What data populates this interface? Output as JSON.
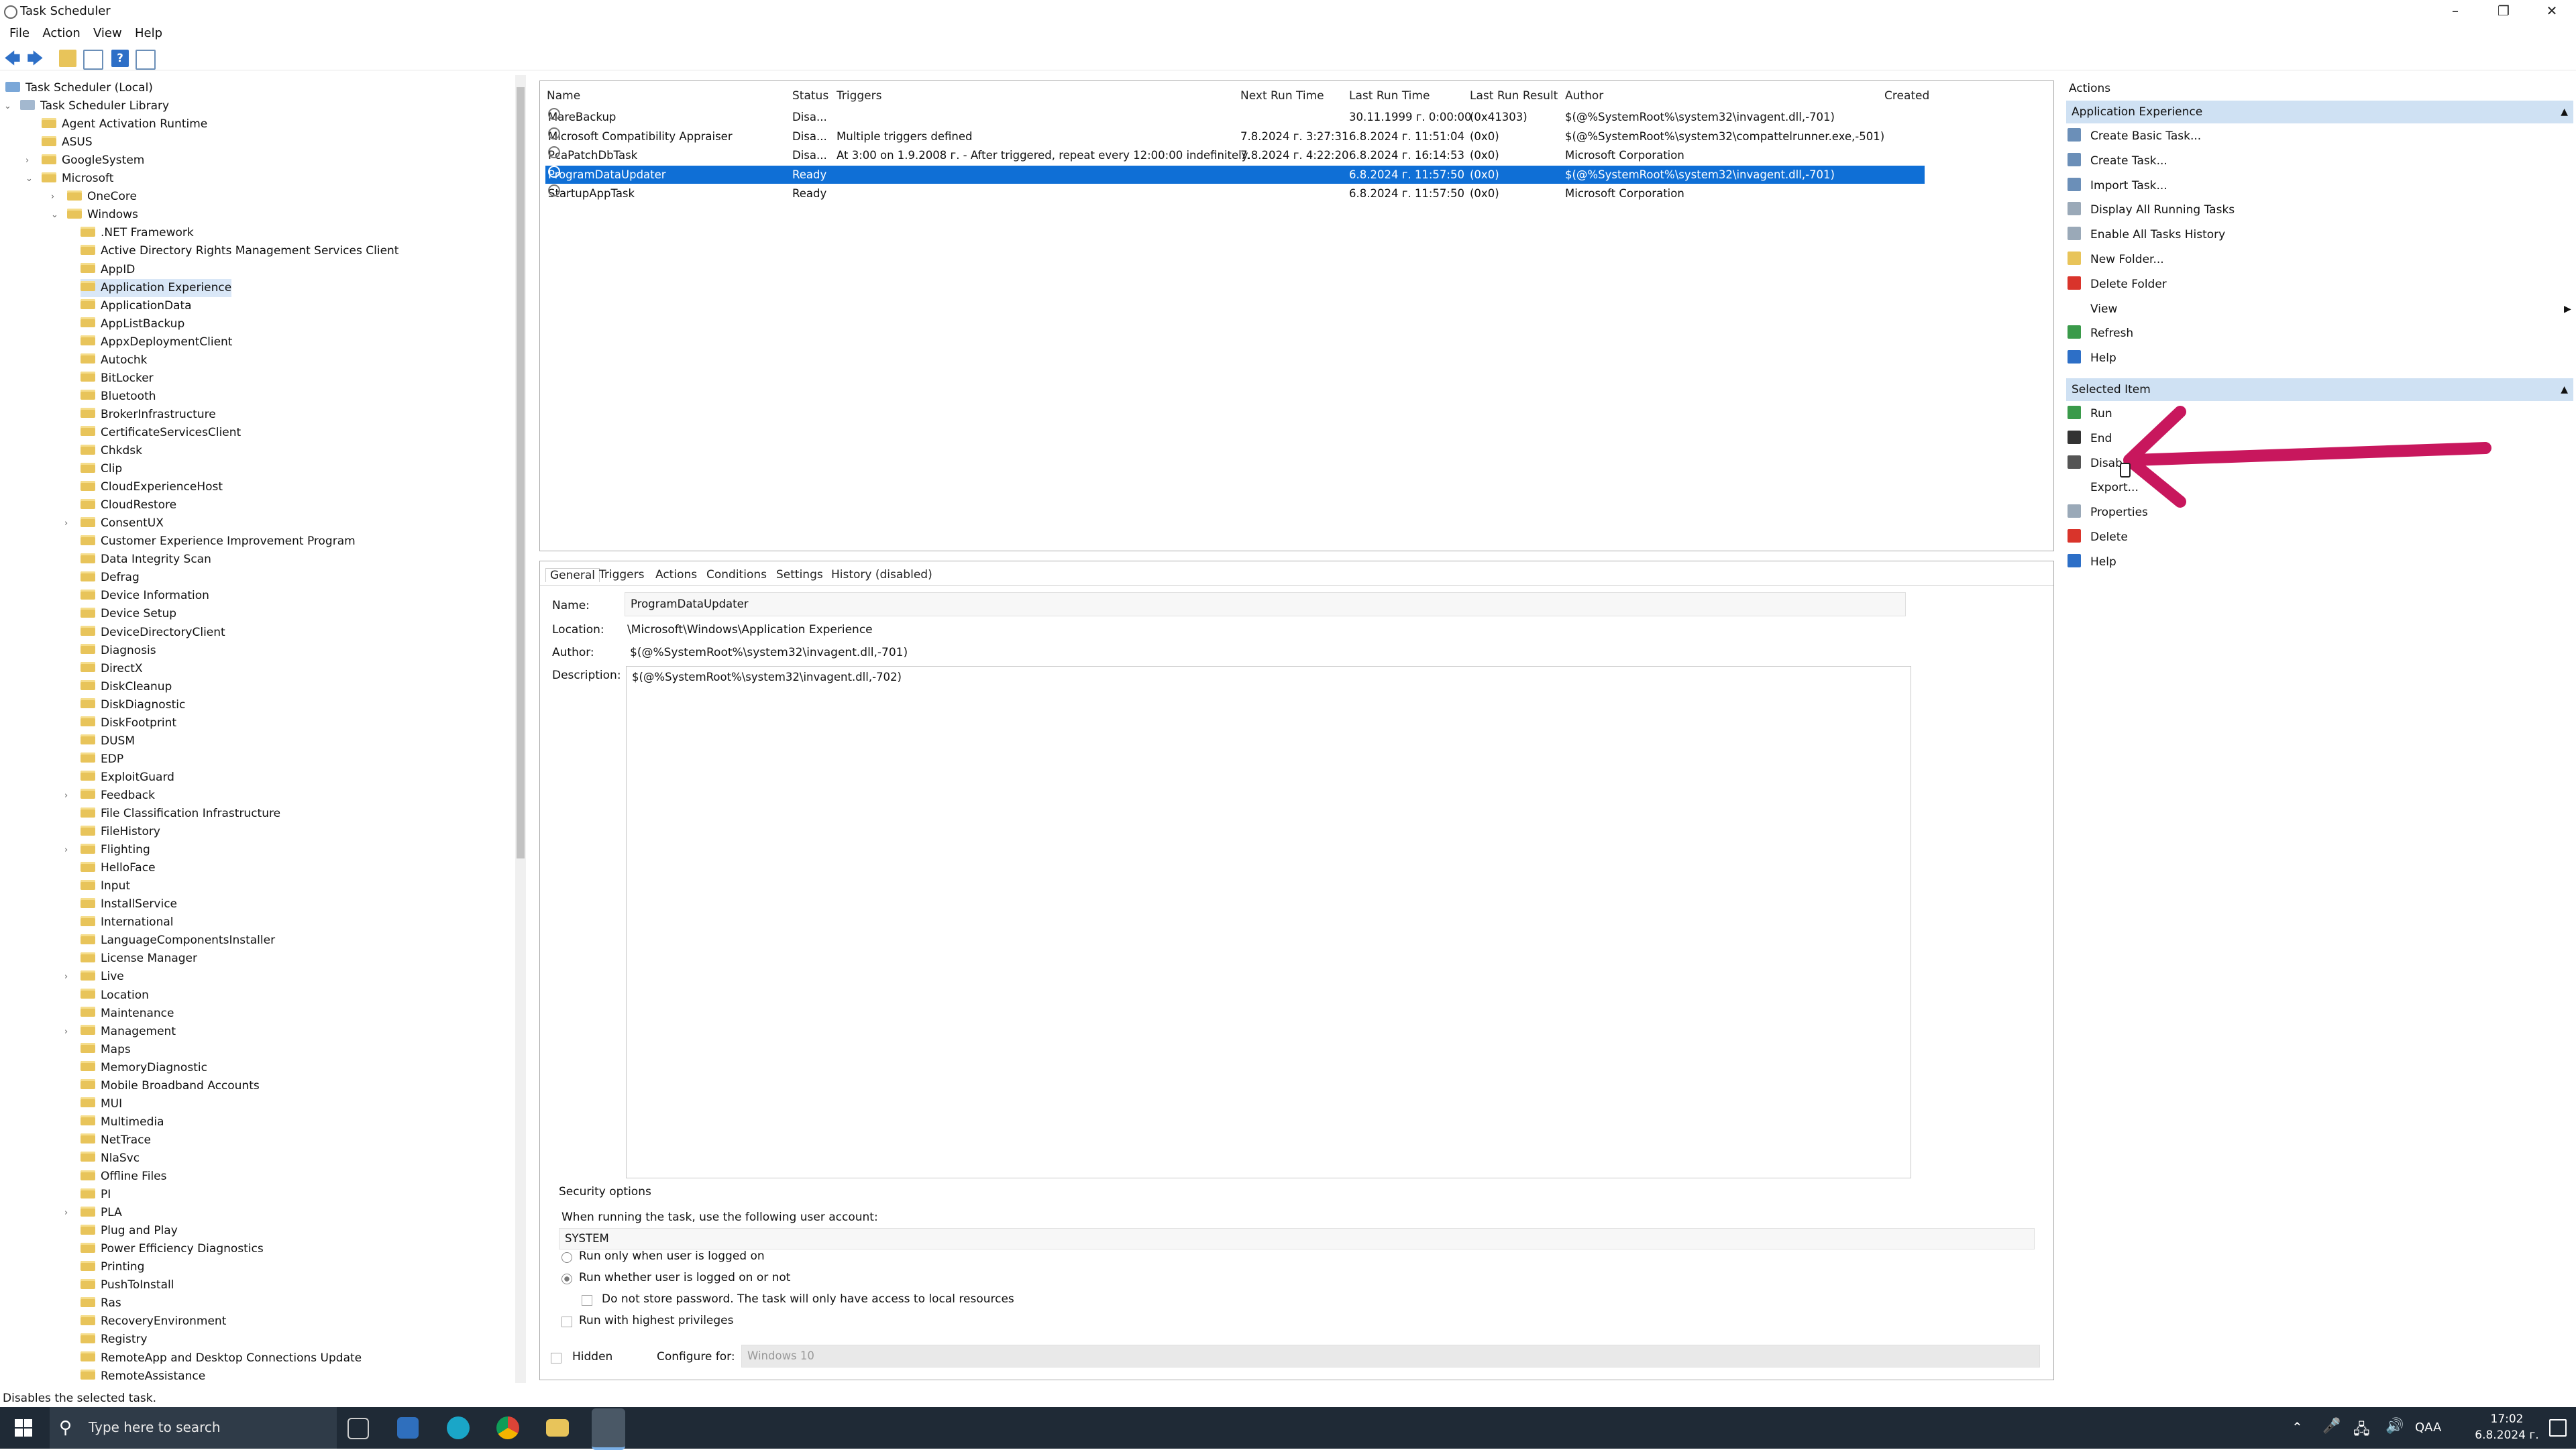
{
  "window": {
    "title": "Task Scheduler"
  },
  "menu": [
    "File",
    "Action",
    "View",
    "Help"
  ],
  "tree": {
    "root": "Task Scheduler (Local)",
    "library": "Task Scheduler Library",
    "top_folders": [
      "Agent Activation Runtime",
      "ASUS",
      "GoogleSystem",
      "Microsoft"
    ],
    "microsoft_children": [
      "OneCore",
      "Windows"
    ],
    "windows_children": [
      ".NET Framework",
      "Active Directory Rights Management Services Client",
      "AppID",
      "Application Experience",
      "ApplicationData",
      "AppListBackup",
      "AppxDeploymentClient",
      "Autochk",
      "BitLocker",
      "Bluetooth",
      "BrokerInfrastructure",
      "CertificateServicesClient",
      "Chkdsk",
      "Clip",
      "CloudExperienceHost",
      "CloudRestore",
      "ConsentUX",
      "Customer Experience Improvement Program",
      "Data Integrity Scan",
      "Defrag",
      "Device Information",
      "Device Setup",
      "DeviceDirectoryClient",
      "Diagnosis",
      "DirectX",
      "DiskCleanup",
      "DiskDiagnostic",
      "DiskFootprint",
      "DUSM",
      "EDP",
      "ExploitGuard",
      "Feedback",
      "File Classification Infrastructure",
      "FileHistory",
      "Flighting",
      "HelloFace",
      "Input",
      "InstallService",
      "International",
      "LanguageComponentsInstaller",
      "License Manager",
      "Live",
      "Location",
      "Maintenance",
      "Management",
      "Maps",
      "MemoryDiagnostic",
      "Mobile Broadband Accounts",
      "MUI",
      "Multimedia",
      "NetTrace",
      "NlaSvc",
      "Offline Files",
      "PI",
      "PLA",
      "Plug and Play",
      "Power Efficiency Diagnostics",
      "Printing",
      "PushToInstall",
      "Ras",
      "RecoveryEnvironment",
      "Registry",
      "RemoteApp and Desktop Connections Update",
      "RemoteAssistance"
    ],
    "selected": "Application Experience"
  },
  "tasks": {
    "columns": [
      "Name",
      "Status",
      "Triggers",
      "Next Run Time",
      "Last Run Time",
      "Last Run Result",
      "Author",
      "Created"
    ],
    "rows": [
      {
        "name": "MareBackup",
        "status": "Disa...",
        "triggers": "",
        "next": "",
        "last": "30.11.1999 г. 0:00:00",
        "result": "(0x41303)",
        "author": "$(@%SystemRoot%\\system32\\invagent.dll,-701)"
      },
      {
        "name": "Microsoft Compatibility Appraiser",
        "status": "Disa...",
        "triggers": "Multiple triggers defined",
        "next": "7.8.2024 г. 3:27:31",
        "last": "6.8.2024 г. 11:51:04",
        "result": "(0x0)",
        "author": "$(@%SystemRoot%\\system32\\compattelrunner.exe,-501)"
      },
      {
        "name": "PcaPatchDbTask",
        "status": "Disa...",
        "triggers": "At 3:00 on 1.9.2008 г. - After triggered, repeat every 12:00:00 indefinitely.",
        "next": "7.8.2024 г. 4:22:20",
        "last": "6.8.2024 г. 16:14:53",
        "result": "(0x0)",
        "author": "Microsoft Corporation"
      },
      {
        "name": "ProgramDataUpdater",
        "status": "Ready",
        "triggers": "",
        "next": "",
        "last": "6.8.2024 г. 11:57:50",
        "result": "(0x0)",
        "author": "$(@%SystemRoot%\\system32\\invagent.dll,-701)"
      },
      {
        "name": "StartupAppTask",
        "status": "Ready",
        "triggers": "",
        "next": "",
        "last": "6.8.2024 г. 11:57:50",
        "result": "(0x0)",
        "author": "Microsoft Corporation"
      }
    ],
    "selected_index": 3
  },
  "details": {
    "tabs": [
      "General",
      "Triggers",
      "Actions",
      "Conditions",
      "Settings",
      "History (disabled)"
    ],
    "name_label": "Name:",
    "name_value": "ProgramDataUpdater",
    "location_label": "Location:",
    "location_value": "\\Microsoft\\Windows\\Application Experience",
    "author_label": "Author:",
    "author_value": "$(@%SystemRoot%\\system32\\invagent.dll,-701)",
    "description_label": "Description:",
    "description_value": "$(@%SystemRoot%\\system32\\invagent.dll,-702)",
    "security_header": "Security options",
    "account_prompt": "When running the task, use the following user account:",
    "account_value": "SYSTEM",
    "radio_logged_on": "Run only when user is logged on",
    "radio_whether": "Run whether user is logged on or not",
    "chk_no_password": "Do not store password.  The task will only have access to local resources",
    "chk_highest": "Run with highest privileges",
    "chk_hidden": "Hidden",
    "configure_label": "Configure for:",
    "configure_value": "Windows 10"
  },
  "actions": {
    "header": "Actions",
    "section1": "Application Experience",
    "section1_items": [
      "Create Basic Task...",
      "Create Task...",
      "Import Task...",
      "Display All Running Tasks",
      "Enable All Tasks History",
      "New Folder...",
      "Delete Folder",
      "View",
      "Refresh",
      "Help"
    ],
    "section2": "Selected Item",
    "section2_items": [
      "Run",
      "End",
      "Disable",
      "Export...",
      "Properties",
      "Delete",
      "Help"
    ]
  },
  "statusbar": "Disables the selected task.",
  "taskbar": {
    "search_placeholder": "Type here to search",
    "language": "QAA",
    "time": "17:02",
    "date": "6.8.2024 г."
  },
  "colors": {
    "selection": "#0f6fd6",
    "section_header": "#cfe1f3",
    "annotation_arrow": "#c8175d"
  }
}
